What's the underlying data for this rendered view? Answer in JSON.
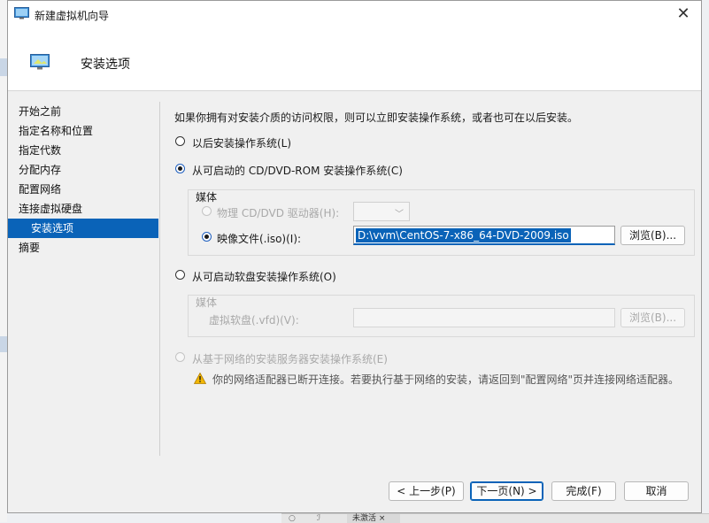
{
  "window": {
    "title": "新建虚拟机向导",
    "close_glyph": "✕",
    "header_title": "安装选项"
  },
  "sidebar": {
    "items": [
      {
        "label": "开始之前"
      },
      {
        "label": "指定名称和位置"
      },
      {
        "label": "指定代数"
      },
      {
        "label": "分配内存"
      },
      {
        "label": "配置网络"
      },
      {
        "label": "连接虚拟硬盘"
      },
      {
        "label": "安装选项",
        "active": true
      },
      {
        "label": "摘要"
      }
    ]
  },
  "content": {
    "intro": "如果你拥有对安装介质的访问权限，则可以立即安装操作系统，或者也可在以后安装。",
    "option_later": "以后安装操作系统(L)",
    "option_cd": "从可启动的 CD/DVD-ROM 安装操作系统(C)",
    "cd_media_group": "媒体",
    "physical_drive_label": "物理 CD/DVD 驱动器(H):",
    "image_file_label": "映像文件(.iso)(I):",
    "image_file_value": "D:\\vvm\\CentOS-7-x86_64-DVD-2009.iso",
    "browse_label": "浏览(B)...",
    "option_floppy": "从可启动软盘安装操作系统(O)",
    "floppy_media_group": "媒体",
    "virtual_floppy_label": "虚拟软盘(.vfd)(V):",
    "floppy_browse_label": "浏览(B)...",
    "option_network": "从基于网络的安装服务器安装操作系统(E)",
    "network_warning": "你的网络适配器已断开连接。若要执行基于网络的安装，请返回到\"配置网络\"页并连接网络适配器。"
  },
  "footer": {
    "prev_label": "< 上一步(P)",
    "next_label": "下一页(N) >",
    "finish_label": "完成(F)",
    "cancel_label": "取消"
  },
  "background": {
    "taskbar_text_1": "○",
    "taskbar_text_2": "ℐ",
    "taskbar_tab": "未激活 ×"
  },
  "colors": {
    "accent": "#0a63b8",
    "warning": "#f2b705"
  }
}
